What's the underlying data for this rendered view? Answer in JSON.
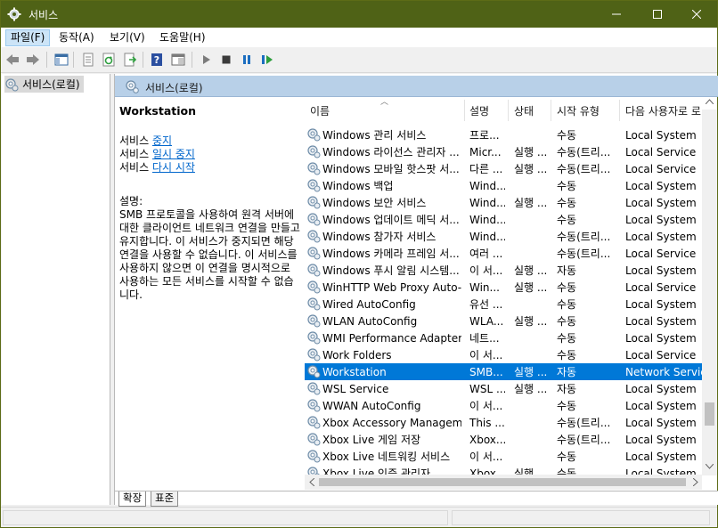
{
  "window": {
    "title": "서비스"
  },
  "menu": [
    {
      "label": "파일(F)",
      "active": true
    },
    {
      "label": "동작(A)"
    },
    {
      "label": "보기(V)"
    },
    {
      "label": "도움말(H)"
    }
  ],
  "tree": {
    "root_label": "서비스(로컬)"
  },
  "panel": {
    "header": "서비스(로컬)"
  },
  "detail": {
    "service_name": "Workstation",
    "action_prefix": "서비스",
    "actions": [
      "중지",
      "일시 중지",
      "다시 시작"
    ],
    "desc_heading": "설명:",
    "description": "SMB 프로토콜을 사용하여 원격 서버에 대한 클라이언트 네트워크 연결을 만들고 유지합니다. 이 서비스가 중지되면 해당 연결을 사용할 수 없습니다. 이 서비스를 사용하지 않으면 이 연결을 명시적으로 사용하는 모든 서비스를 시작할 수 없습니다."
  },
  "columns": {
    "name": "이름",
    "desc": "설명",
    "status": "상태",
    "startup": "시작 유형",
    "logon": "다음 사용자로 로"
  },
  "services": [
    {
      "name": "Windows 관리 서비스",
      "desc": "프로...",
      "status": "",
      "startup": "수동",
      "logon": "Local System"
    },
    {
      "name": "Windows 라이선스 관리자 ...",
      "desc": "Micr...",
      "status": "실행 ...",
      "startup": "수동(트리...",
      "logon": "Local Service"
    },
    {
      "name": "Windows 모바일 핫스팟 서...",
      "desc": "다른 ...",
      "status": "실행 ...",
      "startup": "수동(트리...",
      "logon": "Local Service"
    },
    {
      "name": "Windows 백업",
      "desc": "Wind...",
      "status": "",
      "startup": "수동",
      "logon": "Local System"
    },
    {
      "name": "Windows 보안 서비스",
      "desc": "Wind...",
      "status": "실행 ...",
      "startup": "수동",
      "logon": "Local System"
    },
    {
      "name": "Windows 업데이트 메딕 서...",
      "desc": "Wind...",
      "status": "",
      "startup": "수동",
      "logon": "Local System"
    },
    {
      "name": "Windows 참가자 서비스",
      "desc": "Wind...",
      "status": "",
      "startup": "수동(트리...",
      "logon": "Local System"
    },
    {
      "name": "Windows 카메라 프레임 서...",
      "desc": "여러 ...",
      "status": "",
      "startup": "수동(트리...",
      "logon": "Local Service"
    },
    {
      "name": "Windows 푸시 알림 시스템...",
      "desc": "이 서...",
      "status": "실행 ...",
      "startup": "자동",
      "logon": "Local System"
    },
    {
      "name": "WinHTTP Web Proxy Auto-...",
      "desc": "Win...",
      "status": "실행 ...",
      "startup": "수동",
      "logon": "Local Service"
    },
    {
      "name": "Wired AutoConfig",
      "desc": "유선 ...",
      "status": "",
      "startup": "수동",
      "logon": "Local System"
    },
    {
      "name": "WLAN AutoConfig",
      "desc": "WLA...",
      "status": "실행 ...",
      "startup": "수동",
      "logon": "Local System"
    },
    {
      "name": "WMI Performance Adapter",
      "desc": "네트...",
      "status": "",
      "startup": "수동",
      "logon": "Local System"
    },
    {
      "name": "Work Folders",
      "desc": "이 서...",
      "status": "",
      "startup": "수동",
      "logon": "Local Service"
    },
    {
      "name": "Workstation",
      "desc": "SMB...",
      "status": "실행 ...",
      "startup": "자동",
      "logon": "Network Service",
      "selected": true
    },
    {
      "name": "WSL Service",
      "desc": "WSL ...",
      "status": "실행 ...",
      "startup": "자동",
      "logon": "Local System"
    },
    {
      "name": "WWAN AutoConfig",
      "desc": "이 서...",
      "status": "",
      "startup": "수동",
      "logon": "Local System"
    },
    {
      "name": "Xbox Accessory Managem...",
      "desc": "This ...",
      "status": "",
      "startup": "수동(트리...",
      "logon": "Local System"
    },
    {
      "name": "Xbox Live 게임 저장",
      "desc": "Xbox...",
      "status": "",
      "startup": "수동(트리...",
      "logon": "Local System"
    },
    {
      "name": "Xbox Live 네트워킹 서비스",
      "desc": "이 서...",
      "status": "",
      "startup": "수동",
      "logon": "Local System"
    },
    {
      "name": "Xbox Live 인증 관리자",
      "desc": "Xbox...",
      "status": "실행 ...",
      "startup": "수동",
      "logon": "Local System"
    }
  ],
  "tabs": [
    {
      "label": "확장",
      "active": true
    },
    {
      "label": "표준",
      "active": false
    }
  ],
  "colors": {
    "titlebar": "#4f6216",
    "selection": "#0078d7",
    "panel_header": "#b8d0e8",
    "link": "#0066cc"
  }
}
